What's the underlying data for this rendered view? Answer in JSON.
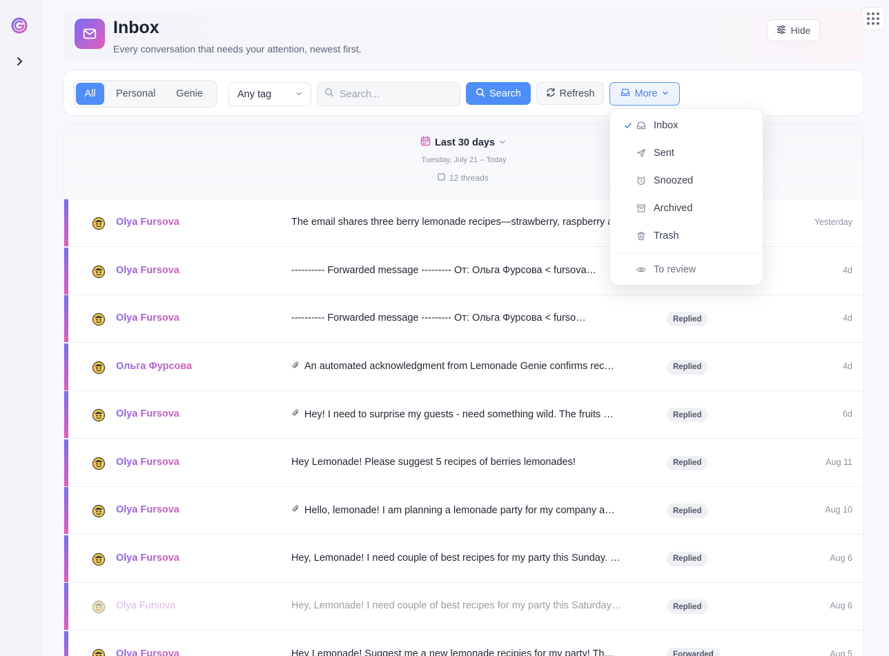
{
  "header": {
    "title": "Inbox",
    "subtitle": "Every conversation that needs your attention, newest first.",
    "hide_label": "Hide"
  },
  "toolbar": {
    "segments": [
      "All",
      "Personal",
      "Genie"
    ],
    "active_segment": "All",
    "tag_select": "Any tag",
    "search_placeholder": "Search...",
    "search_label": "Search",
    "refresh_label": "Refresh",
    "more_label": "More"
  },
  "dropdown": {
    "items": [
      "Inbox",
      "Sent",
      "Snoozed",
      "Archived",
      "Trash"
    ],
    "checked": "Inbox",
    "extra": "To review"
  },
  "range": {
    "title": "Last 30 days",
    "dates": "Tuesday, July 21 – Today",
    "count": "12 threads"
  },
  "threads": [
    {
      "sender": "Olya Fursova",
      "subject": "The email shares three berry lemonade recipes—strawberry, raspberry and blueberry—with easy steps…",
      "attachment": false,
      "badge": "",
      "date": "Yesterday",
      "faded": false
    },
    {
      "sender": "Olya Fursova",
      "subject": "---------- Forwarded message --------- От: Ольга Фурсова < fursova…",
      "attachment": false,
      "badge": "",
      "date": "4d",
      "faded": false
    },
    {
      "sender": "Olya Fursova",
      "subject": "---------- Forwarded message --------- От: Ольга Фурсова < furso…",
      "attachment": false,
      "badge": "Replied",
      "date": "4d",
      "faded": false
    },
    {
      "sender": "Ольга Фурсова",
      "subject": "An automated acknowledgment from Lemonade Genie confirms rec…",
      "attachment": true,
      "badge": "Replied",
      "date": "4d",
      "faded": false
    },
    {
      "sender": "Olya Fursova",
      "subject": "Hey!  I need to surprise my guests - need something wild. The fruits …",
      "attachment": true,
      "badge": "Replied",
      "date": "6d",
      "faded": false
    },
    {
      "sender": "Olya Fursova",
      "subject": "Hey Lemonade! Please suggest 5 recipes of berries lemonades!",
      "attachment": false,
      "badge": "Replied",
      "date": "Aug 11",
      "faded": false
    },
    {
      "sender": "Olya Fursova",
      "subject": "Hello, lemonade! I am planning a lemonade party for my company a…",
      "attachment": true,
      "badge": "Replied",
      "date": "Aug 10",
      "faded": false
    },
    {
      "sender": "Olya Fursova",
      "subject": "Hey, Lemonade! I need couple of best recipes for my party this Sunday. …",
      "attachment": false,
      "badge": "Replied",
      "date": "Aug 6",
      "faded": false
    },
    {
      "sender": "Olya Fursova",
      "subject": "Hey, Lemonade! I need couple of best recipes for my party this Saturday…",
      "attachment": false,
      "badge": "Replied",
      "date": "Aug 6",
      "faded": true
    },
    {
      "sender": "Olya Fursova",
      "subject": "Hey Lemonade! Suggest me a new lemonade recipies for my party! Th…",
      "attachment": false,
      "badge": "Forwarded",
      "date": "Aug 5",
      "faded": false
    }
  ],
  "colors": {
    "accent": "#4f8ef7",
    "gradient_start": "#7b6cf6",
    "gradient_end": "#e05fb8"
  }
}
